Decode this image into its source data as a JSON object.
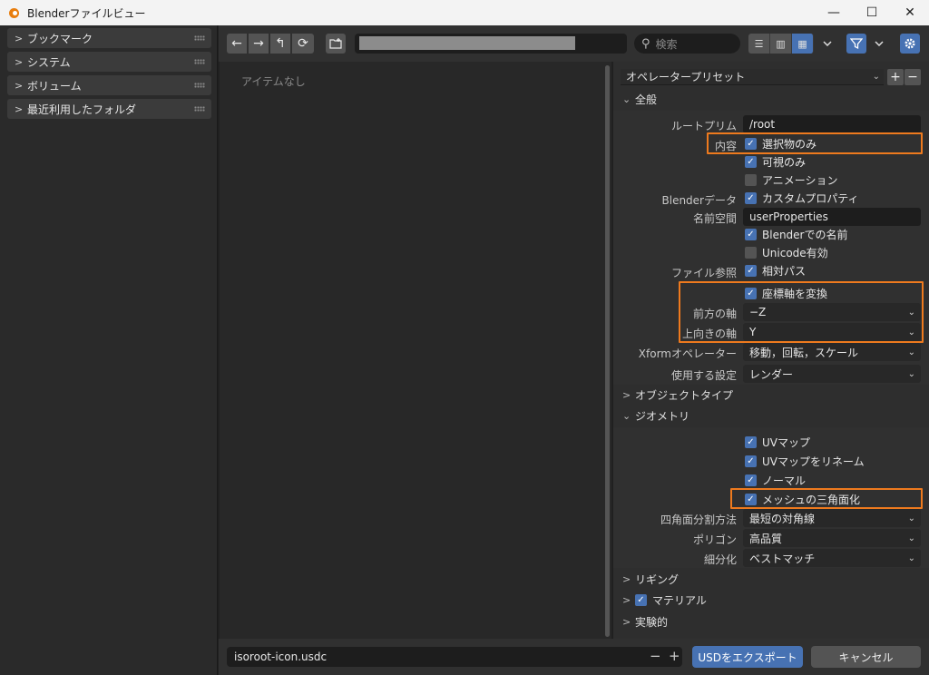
{
  "window": {
    "title": "Blenderファイルビュー",
    "minimize": "—",
    "maximize": "☐",
    "close": "✕"
  },
  "sidebar": {
    "panels": [
      {
        "label": "ブックマーク"
      },
      {
        "label": "システム"
      },
      {
        "label": "ボリューム"
      },
      {
        "label": "最近利用したフォルダ"
      }
    ]
  },
  "toolbar": {
    "back": "←",
    "forward": "→",
    "parent": "↰",
    "refresh": "⟳",
    "search_placeholder": "検索"
  },
  "filelist": {
    "empty_text": "アイテムなし"
  },
  "props": {
    "preset_label": "オペレータープリセット",
    "preset_add": "+",
    "preset_remove": "−",
    "general": {
      "header": "全般",
      "root_prim_label": "ルートプリム",
      "root_prim_value": "/root",
      "content_label": "内容",
      "selected_only": "選択物のみ",
      "visible_only": "可視のみ",
      "animation": "アニメーション",
      "blender_data_label": "Blenderデータ",
      "custom_props": "カスタムプロパティ",
      "namespace_label": "名前空間",
      "namespace_value": "userProperties",
      "blender_names": "Blenderでの名前",
      "unicode": "Unicode有効",
      "file_ref_label": "ファイル参照",
      "relative_paths": "相対パス",
      "convert_axes": "座標軸を変換",
      "forward_axis_label": "前方の軸",
      "forward_axis_value": "−Z",
      "up_axis_label": "上向きの軸",
      "up_axis_value": "Y",
      "xform_label": "Xformオペレーター",
      "xform_value": "移動，回転，スケール",
      "use_settings_label": "使用する設定",
      "use_settings_value": "レンダー"
    },
    "object_types": {
      "header": "オブジェクトタイプ"
    },
    "geometry": {
      "header": "ジオメトリ",
      "uv_maps": "UVマップ",
      "rename_uv": "UVマップをリネーム",
      "normals": "ノーマル",
      "triangulate": "メッシュの三角面化",
      "quad_method_label": "四角面分割方法",
      "quad_method_value": "最短の対角線",
      "polygon_label": "ポリゴン",
      "polygon_value": "高品質",
      "subdiv_label": "細分化",
      "subdiv_value": "ベストマッチ"
    },
    "rigging": {
      "header": "リギング"
    },
    "materials": {
      "header": "マテリアル"
    },
    "experimental": {
      "header": "実験的"
    }
  },
  "bottom": {
    "filename": "isoroot-icon.usdc",
    "minus": "−",
    "plus": "+",
    "export_button": "USDをエクスポート",
    "cancel_button": "キャンセル"
  },
  "colors": {
    "accent": "#4772b3",
    "highlight": "#ee7a1e",
    "background": "#2e2e2e"
  }
}
